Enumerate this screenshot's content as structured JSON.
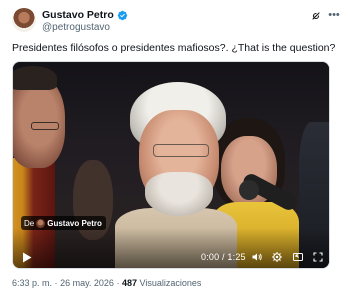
{
  "author": {
    "display_name": "Gustavo Petro",
    "handle": "@petrogustavo",
    "verified": true,
    "verified_color": "#1d9bf0"
  },
  "tweet": {
    "text": "Presidentes filósofos o presidentes mafiosos?. ¿That is the question?"
  },
  "video": {
    "source_prefix": "De",
    "source_name": "Gustavo Petro",
    "time": "0:00 / 1:25"
  },
  "meta": {
    "time": "6:33 p. m.",
    "separator": "·",
    "date": "26 may. 2026",
    "views_count": "487",
    "views_label": "Visualizaciones"
  },
  "icons": {
    "grok": "grok-icon",
    "more": "more-icon",
    "play": "play-icon",
    "volume": "volume-icon",
    "settings": "gear-icon",
    "pip": "picture-in-picture-icon",
    "fullscreen": "fullscreen-icon"
  }
}
